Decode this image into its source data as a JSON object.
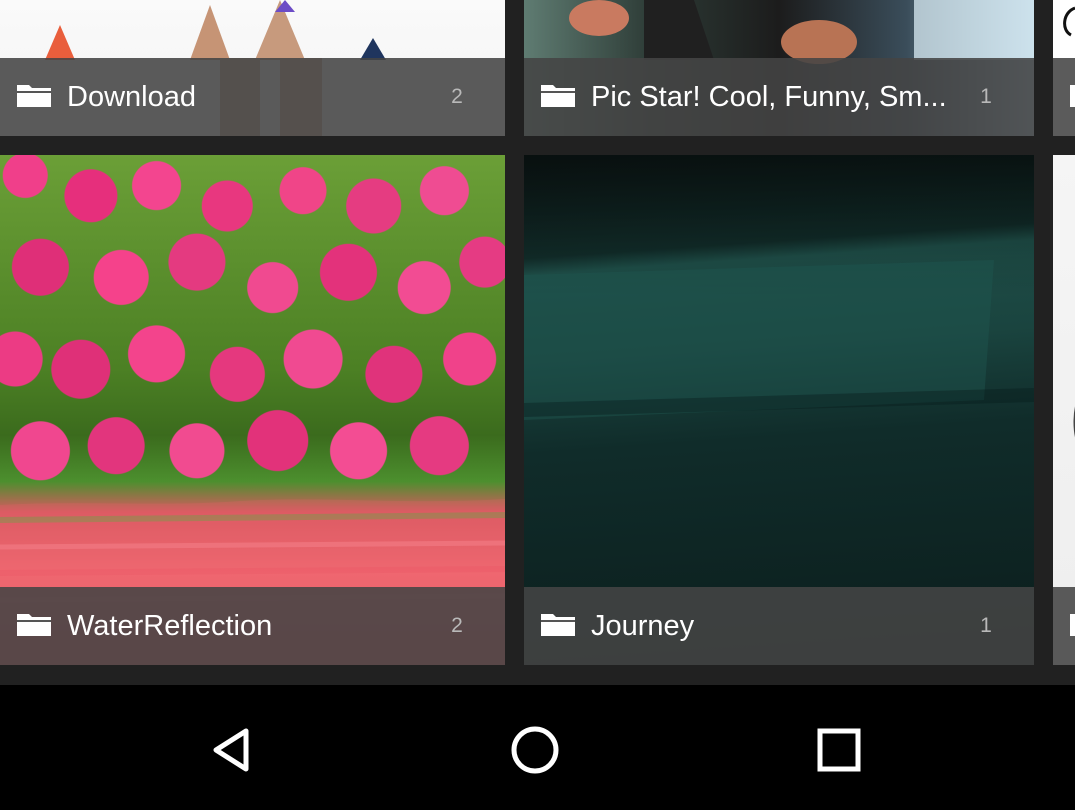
{
  "albums": [
    {
      "name": "Download",
      "count": "2",
      "thumbnail": "pencils-photo"
    },
    {
      "name": "Pic Star! Cool, Funny, Sm...",
      "count": "1",
      "thumbnail": "surfer-photo"
    },
    {
      "name": "WaterReflection",
      "count": "2",
      "thumbnail": "tulips-reflection-photo"
    },
    {
      "name": "Journey",
      "count": "1",
      "thumbnail": "dark-green-photo"
    }
  ],
  "colors": {
    "label_bar": "#444444",
    "label_text": "#ffffff",
    "count_text": "#b9b9b9",
    "grid_background": "#212121",
    "nav_background": "#000000"
  },
  "nav": {
    "back_icon": "back-triangle-icon",
    "home_icon": "home-circle-icon",
    "recents_icon": "recents-square-icon"
  }
}
